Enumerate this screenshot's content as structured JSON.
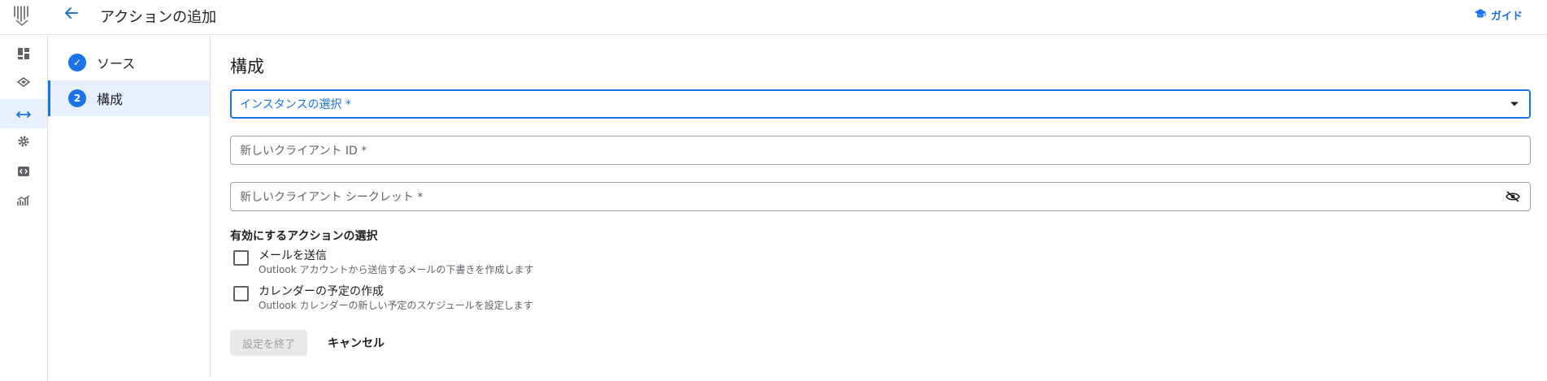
{
  "header": {
    "title": "アクションの追加",
    "guide_label": "ガイド",
    "back_icon": "arrow-back-icon",
    "guide_icon": "graduation-cap-icon",
    "logo_icon": "app-logo-icon"
  },
  "rail": {
    "items": [
      {
        "icon": "dashboard-icon"
      },
      {
        "icon": "layers-icon"
      },
      {
        "icon": "connections-icon",
        "active": true
      },
      {
        "icon": "gear-icon"
      },
      {
        "icon": "code-icon"
      },
      {
        "icon": "analytics-icon"
      }
    ]
  },
  "steps": [
    {
      "marker": "✓",
      "label": "ソース",
      "status": "completed"
    },
    {
      "marker": "2",
      "label": "構成",
      "status": "active"
    }
  ],
  "main": {
    "section_title": "構成",
    "instance_select": {
      "label": "インスタンスの選択 *"
    },
    "client_id": {
      "label": "新しいクライアント ID *"
    },
    "client_secret": {
      "label": "新しいクライアント シークレット *"
    },
    "actions_heading": "有効にするアクションの選択",
    "actions": [
      {
        "label": "メールを送信",
        "description": "Outlook アカウントから送信するメールの下書きを作成します",
        "checked": false
      },
      {
        "label": "カレンダーの予定の作成",
        "description": "Outlook カレンダーの新しい予定のスケジュールを設定します",
        "checked": false
      }
    ],
    "finish_button": "設定を終了",
    "cancel_button": "キャンセル"
  },
  "colors": {
    "accent": "#1a73e8",
    "border": "#e0e0e0",
    "active_bg": "#e8f0fe"
  }
}
